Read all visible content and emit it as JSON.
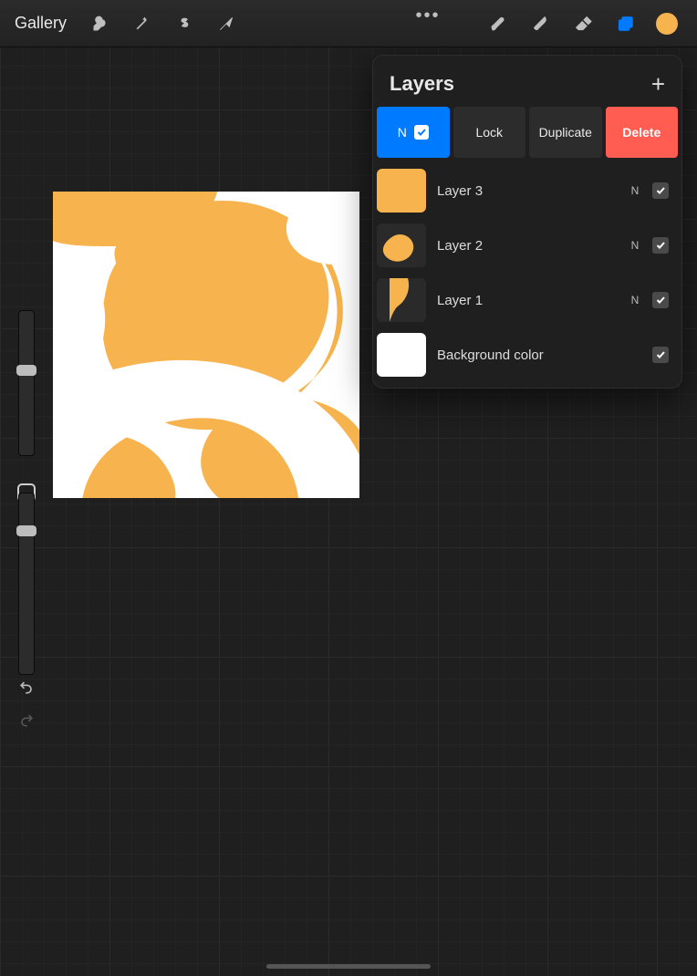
{
  "topbar": {
    "gallery_label": "Gallery"
  },
  "colors": {
    "accent": "#f7b34d",
    "blue": "#007aff",
    "red": "#ff5c52"
  },
  "layers_panel": {
    "title": "Layers",
    "actions": {
      "blend_mode": "N",
      "lock": "Lock",
      "duplicate": "Duplicate",
      "delete": "Delete"
    },
    "layers": [
      {
        "name": "Layer 3",
        "blend": "N",
        "visible": true
      },
      {
        "name": "Layer 2",
        "blend": "N",
        "visible": true
      },
      {
        "name": "Layer 1",
        "blend": "N",
        "visible": true
      }
    ],
    "background": {
      "name": "Background color",
      "visible": true
    }
  }
}
